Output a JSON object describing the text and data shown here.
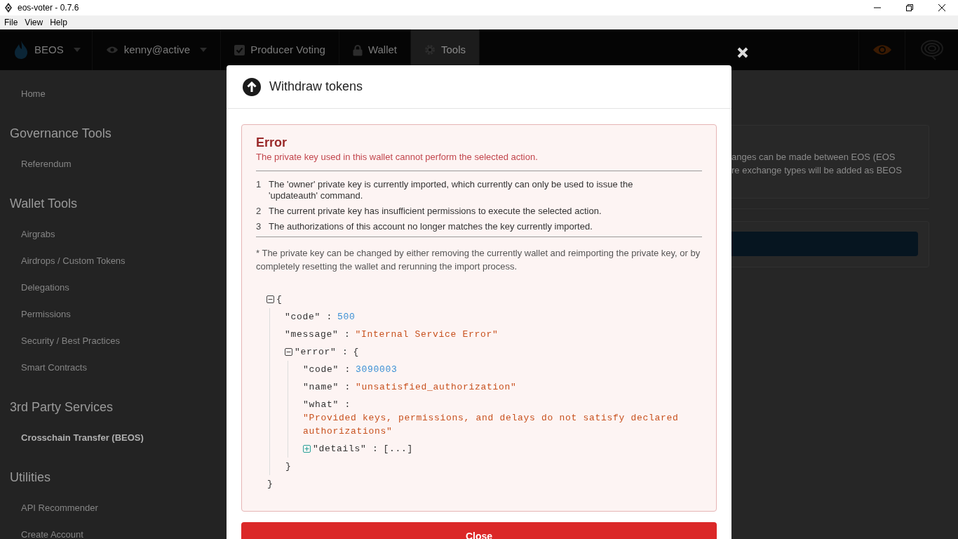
{
  "window": {
    "title": "eos-voter - 0.7.6"
  },
  "menu": [
    "File",
    "View",
    "Help"
  ],
  "navbar": {
    "items": [
      {
        "kind": "chain",
        "label": "BEOS",
        "selected": false
      },
      {
        "kind": "account",
        "label": "kenny@active",
        "selected": false
      },
      {
        "kind": "voting",
        "label": "Producer Voting",
        "selected": false
      },
      {
        "kind": "wallet",
        "label": "Wallet",
        "selected": false
      },
      {
        "kind": "tools",
        "label": "Tools",
        "selected": true
      }
    ]
  },
  "sidebar": {
    "sections": [
      {
        "items": [
          {
            "label": "Home",
            "selected": false
          }
        ]
      },
      {
        "heading": "Governance Tools",
        "items": [
          {
            "label": "Referendum",
            "selected": false
          }
        ]
      },
      {
        "heading": "Wallet Tools",
        "items": [
          {
            "label": "Airgrabs",
            "selected": false
          },
          {
            "label": "Airdrops / Custom Tokens",
            "selected": false
          },
          {
            "label": "Delegations",
            "selected": false
          },
          {
            "label": "Permissions",
            "selected": false
          },
          {
            "label": "Security / Best Practices",
            "selected": false
          },
          {
            "label": "Smart Contracts",
            "selected": false
          }
        ]
      },
      {
        "heading": "3rd Party Services",
        "items": [
          {
            "label": "Crosschain Transfer (BEOS)",
            "selected": true
          }
        ]
      },
      {
        "heading": "Utilities",
        "items": [
          {
            "label": "API Recommender",
            "selected": false
          },
          {
            "label": "Create Account",
            "selected": false
          }
        ]
      }
    ]
  },
  "background_panel": {
    "text_lines": [
      "anges can be made between EOS (EOS",
      "re exchange types will be added as BEOS"
    ]
  },
  "modal": {
    "title": "Withdraw tokens",
    "error": {
      "title": "Error",
      "message": "The private key used in this wallet cannot perform the selected action.",
      "reasons": [
        {
          "number": "1",
          "text": "The 'owner' private key is currently imported, which currently can only be used to issue the 'updateauth' command."
        },
        {
          "number": "2",
          "text": "The current private key has insufficient permissions to execute the selected action."
        },
        {
          "number": "3",
          "text": "The authorizations of this account no longer matches the key currently imported."
        }
      ],
      "note": "* The private key can be changed by either removing the currently wallet and reimporting the private key, or by completely resetting the wallet and rerunning the import process.",
      "json_view": {
        "kind": "object",
        "expanded": true,
        "open": "{",
        "close": "}",
        "children": [
          {
            "kind": "number",
            "key": "\"code\" :",
            "value": "500"
          },
          {
            "kind": "string",
            "key": "\"message\" :",
            "value": "\"Internal Service Error\""
          },
          {
            "kind": "object",
            "key": "\"error\" :",
            "expanded": true,
            "open": "{",
            "close": "}",
            "children": [
              {
                "kind": "number",
                "key": "\"code\" :",
                "value": "3090003"
              },
              {
                "kind": "string",
                "key": "\"name\" :",
                "value": "\"unsatisfied_authorization\""
              },
              {
                "kind": "string",
                "key": "\"what\" :",
                "value": "\"Provided keys, permissions, and delays do not satisfy declared authorizations\""
              },
              {
                "kind": "object",
                "key": "\"details\" :",
                "expanded": false,
                "summary": "[...]"
              }
            ]
          }
        ]
      }
    },
    "buttons": [
      "Close"
    ]
  }
}
